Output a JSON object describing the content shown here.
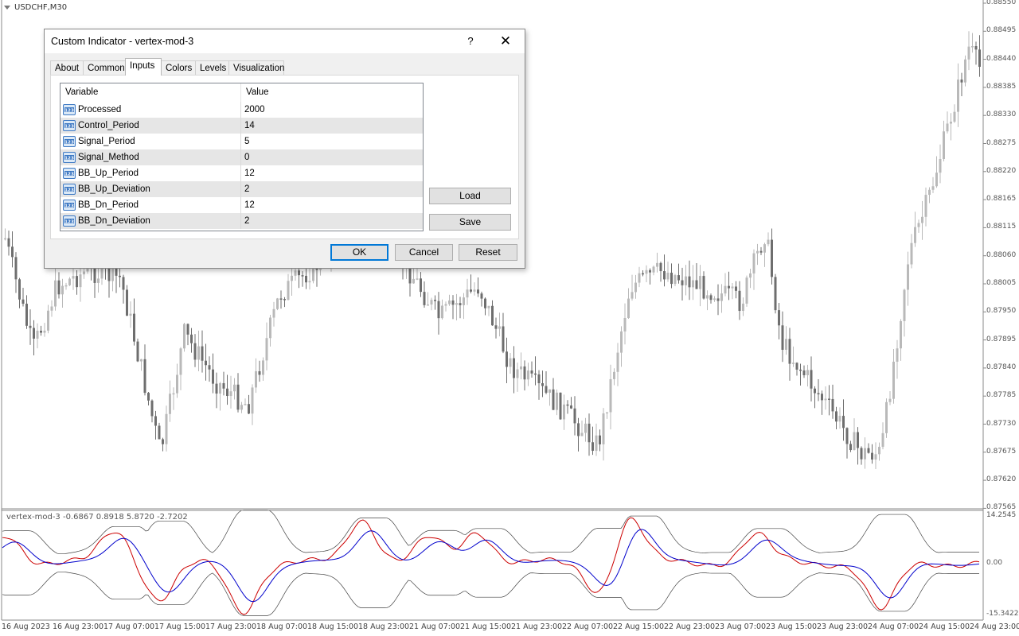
{
  "chart": {
    "symbol_title": "USDCHF,M30",
    "indicator_title": "vertex-mod-3 -0.6867 0.8918 5.8720 -2.7202",
    "price_labels": [
      "0.88550",
      "0.88495",
      "0.88440",
      "0.88385",
      "0.88330",
      "0.88275",
      "0.88220",
      "0.88165",
      "0.88115",
      "0.88060",
      "0.88005",
      "0.87950",
      "0.87895",
      "0.87840",
      "0.87785",
      "0.87730",
      "0.87675",
      "0.87620",
      "0.87565"
    ],
    "indicator_labels": [
      "14.2545",
      "0.00",
      "-15.3422"
    ],
    "time_labels": [
      "16 Aug 2023",
      "16 Aug 23:00",
      "17 Aug 07:00",
      "17 Aug 15:00",
      "17 Aug 23:00",
      "18 Aug 07:00",
      "18 Aug 15:00",
      "18 Aug 23:00",
      "21 Aug 07:00",
      "21 Aug 15:00",
      "21 Aug 23:00",
      "22 Aug 07:00",
      "22 Aug 15:00",
      "22 Aug 23:00",
      "23 Aug 07:00",
      "23 Aug 15:00",
      "23 Aug 23:00",
      "24 Aug 07:00",
      "24 Aug 15:00",
      "24 Aug 23:00"
    ],
    "colors": {
      "bull_candle": "#b9b9b9",
      "bear_candle": "#6e6e6e",
      "signal_line": "#0000cc",
      "vertex_line": "#cc0000",
      "band_line": "#444444"
    }
  },
  "dialog": {
    "title": "Custom Indicator - vertex-mod-3",
    "help_label": "?",
    "close_label": "✕",
    "tabs": [
      {
        "label": "About",
        "active": false
      },
      {
        "label": "Common",
        "active": false
      },
      {
        "label": "Inputs",
        "active": true
      },
      {
        "label": "Colors",
        "active": false
      },
      {
        "label": "Levels",
        "active": false
      },
      {
        "label": "Visualization",
        "active": false
      }
    ],
    "grid": {
      "headers": {
        "variable": "Variable",
        "value": "Value"
      },
      "rows": [
        {
          "icon": "numeric-123-icon",
          "variable": "Processed",
          "value": "2000"
        },
        {
          "icon": "numeric-123-icon",
          "variable": "Control_Period",
          "value": "14"
        },
        {
          "icon": "numeric-123-icon",
          "variable": "Signal_Period",
          "value": "5"
        },
        {
          "icon": "numeric-123-icon",
          "variable": "Signal_Method",
          "value": "0"
        },
        {
          "icon": "numeric-123-icon",
          "variable": "BB_Up_Period",
          "value": "12"
        },
        {
          "icon": "numeric-123-icon",
          "variable": "BB_Up_Deviation",
          "value": "2"
        },
        {
          "icon": "numeric-123-icon",
          "variable": "BB_Dn_Period",
          "value": "12"
        },
        {
          "icon": "numeric-123-icon",
          "variable": "BB_Dn_Deviation",
          "value": "2"
        }
      ]
    },
    "buttons": {
      "load": "Load",
      "save": "Save",
      "ok": "OK",
      "cancel": "Cancel",
      "reset": "Reset"
    }
  }
}
